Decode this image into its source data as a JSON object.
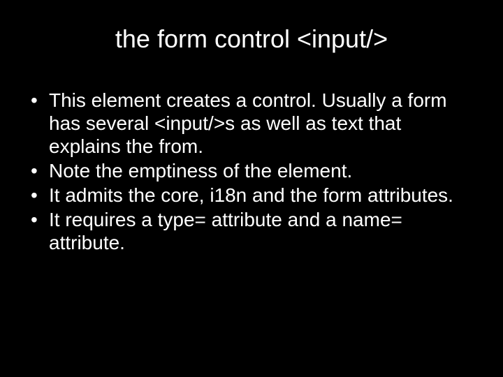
{
  "slide": {
    "title": "the form control <input/>",
    "bullets": [
      "This element creates a control. Usually a form has several <input/>s as well as text that explains the from.",
      "Note the emptiness of the element.",
      "It admits the core, i18n and the form attributes.",
      "It requires a type= attribute and a name= attribute."
    ]
  }
}
